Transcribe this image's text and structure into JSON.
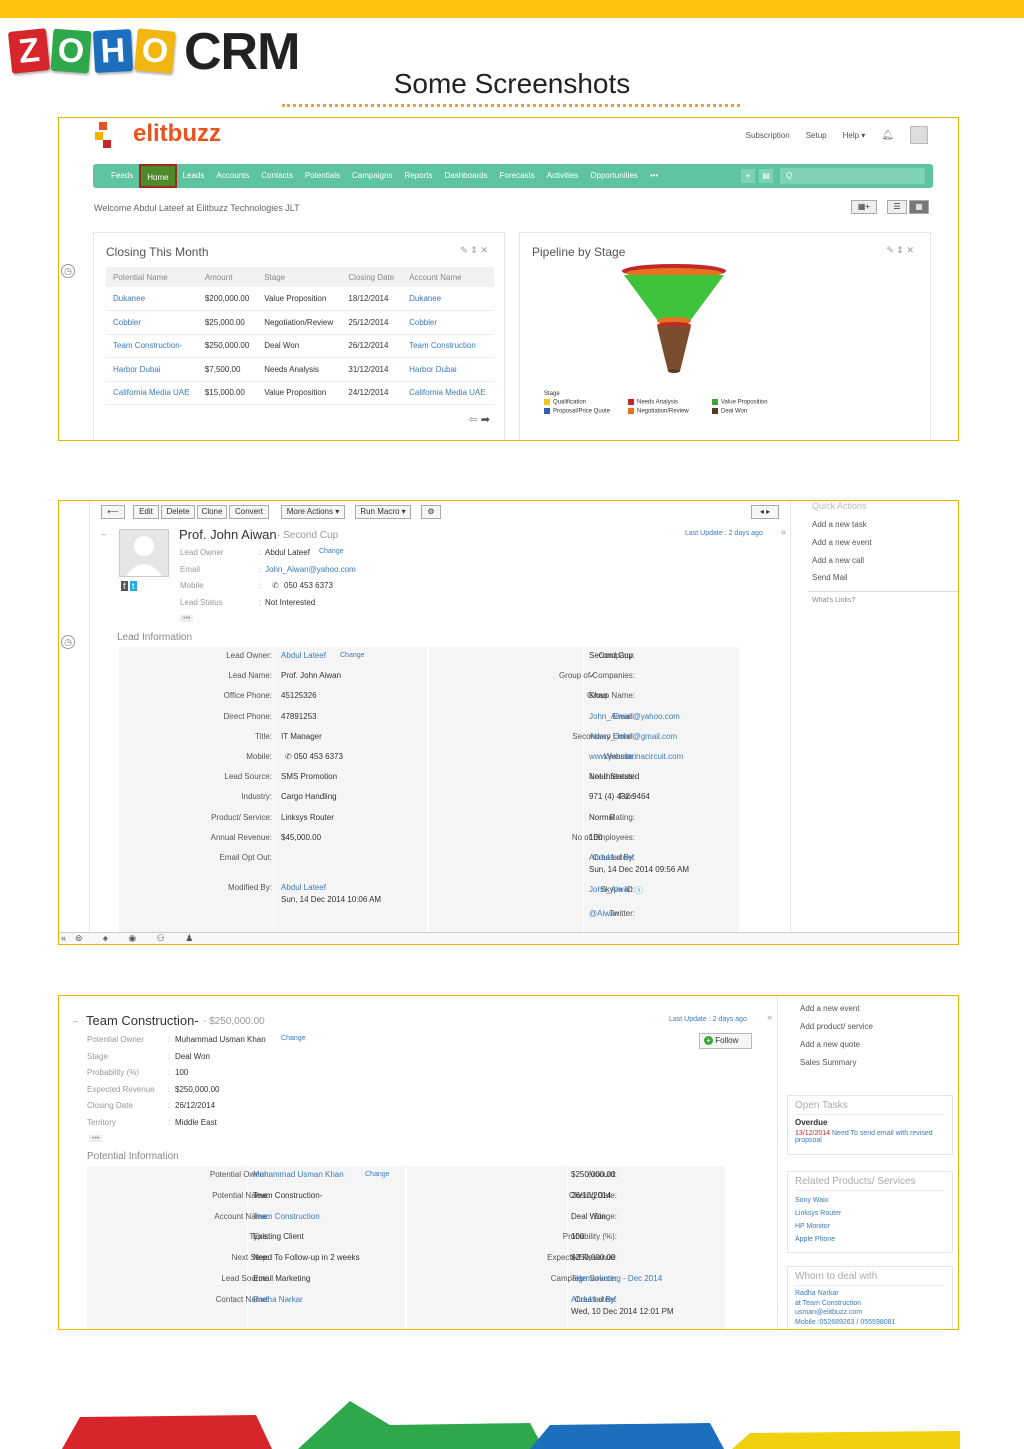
{
  "header": {
    "brand": "ZOHO",
    "product": "CRM",
    "title": "Some Screenshots"
  },
  "shot1": {
    "brand": "elitbuzz",
    "topnav": [
      "Subscription",
      "Setup",
      "Help"
    ],
    "nav": [
      "Feeds",
      "Home",
      "Leads",
      "Accounts",
      "Contacts",
      "Potentials",
      "Campaigns",
      "Reports",
      "Dashboards",
      "Forecasts",
      "Activities",
      "Opportunities",
      "•••"
    ],
    "search_placeholder": "Q",
    "welcome": "Welcome Abdul Lateef at Elitbuzz Technologies JLT",
    "closing": {
      "title": "Closing This Month",
      "columns": [
        "Potential Name",
        "Amount",
        "Stage",
        "Closing Date",
        "Account Name"
      ],
      "rows": [
        [
          "Dukanee",
          "$200,000.00",
          "Value Proposition",
          "18/12/2014",
          "Dukanee"
        ],
        [
          "Cobbler",
          "$25,000.00",
          "Negotiation/Review",
          "25/12/2014",
          "Cobbler"
        ],
        [
          "Team Construction-",
          "$250,000.00",
          "Deal Won",
          "26/12/2014",
          "Team Construction"
        ],
        [
          "Harbor Dubai",
          "$7,500.00",
          "Needs Analysis",
          "31/12/2014",
          "Harbor Dubai"
        ],
        [
          "California Media UAE",
          "$15,000.00",
          "Value Proposition",
          "24/12/2014",
          "California Media UAE"
        ]
      ]
    },
    "pipeline": {
      "title": "Pipeline by Stage",
      "legend_title": "Stage",
      "legend": [
        {
          "label": "Qualification",
          "color": "#f0c419"
        },
        {
          "label": "Needs Analysis",
          "color": "#c0282a"
        },
        {
          "label": "Value Proposition",
          "color": "#3aa635"
        },
        {
          "label": "Proposal/Price Quote",
          "color": "#2e5db3"
        },
        {
          "label": "Negotiation/Review",
          "color": "#e8731f"
        },
        {
          "label": "Deal Won",
          "color": "#5a3a22"
        }
      ]
    }
  },
  "shot2": {
    "toolbar": [
      "Edit",
      "Delete",
      "Clone",
      "Convert",
      "More Actions ▾",
      "Run Macro ▾"
    ],
    "name": "Prof. John Aiwan",
    "company_suffix": "- Second Cup",
    "last_update": "Last Update : 2 days ago",
    "summary": [
      {
        "label": "Lead Owner",
        "value": "Abdul Lateef",
        "extra": "Change"
      },
      {
        "label": "Email",
        "value": "John_Aiwan@yahoo.com"
      },
      {
        "label": "Mobile",
        "value": "050 453 6373"
      },
      {
        "label": "Lead Status",
        "value": "Not Interested"
      }
    ],
    "section": "Lead Information",
    "left": [
      [
        "Lead Owner:",
        "Abdul Lateef"
      ],
      [
        "Lead Name:",
        "Prof. John Aiwan"
      ],
      [
        "Office Phone:",
        "45125326"
      ],
      [
        "Direct Phone:",
        "47891253"
      ],
      [
        "Title:",
        "IT Manager"
      ],
      [
        "Mobile:",
        "050 453 6373"
      ],
      [
        "Lead Source:",
        "SMS Promotion"
      ],
      [
        "Industry:",
        "Cargo Handling"
      ],
      [
        "Product/ Service:",
        "Linksys Router"
      ],
      [
        "Annual Revenue:",
        "$45,000.00"
      ],
      [
        "Email Opt Out:",
        ""
      ],
      [
        "Modified By:",
        "Abdul Lateef"
      ]
    ],
    "change": "Change",
    "modified_date": "Sun, 14 Dec 2014 10:06 AM",
    "right": [
      [
        "Company:",
        "Second Cup"
      ],
      [
        "Group of Companies:",
        "✓"
      ],
      [
        "Group Name:",
        "Khan"
      ],
      [
        "Email:",
        "John_Aiwan@yahoo.com"
      ],
      [
        "Secondary Email:",
        "Aiwan_John@gmail.com"
      ],
      [
        "Website:",
        "www.yasmarinacircuit.com"
      ],
      [
        "Lead Status:",
        "Not Interested"
      ],
      [
        "Fax:",
        "971 (4) 432 9464"
      ],
      [
        "Rating:",
        "Normal"
      ],
      [
        "No of Employees:",
        "100"
      ],
      [
        "Created By:",
        "Abdul Lateef"
      ],
      [
        "Skype ID:",
        "John_Aiwan"
      ],
      [
        "Twitter:",
        "@Aiwan"
      ]
    ],
    "created_date": "Sun, 14 Dec 2014 09:56 AM",
    "quick_title": "Quick Actions",
    "quick": [
      "Add a new task",
      "Add a new event",
      "Add a new call",
      "Send Mail"
    ],
    "whats_links": "What's Links?"
  },
  "shot3": {
    "name": "Team Construction-",
    "amount": "- $250,000.00",
    "last_update": "Last Update : 2 days ago",
    "follow": "Follow",
    "summary": [
      [
        "Potential Owner",
        "Muhammad Usman Khan"
      ],
      [
        "Stage",
        "Deal Won"
      ],
      [
        "Probability (%)",
        "100"
      ],
      [
        "Expected Revenue",
        "$250,000.00"
      ],
      [
        "Closing Date",
        "26/12/2014"
      ],
      [
        "Territory",
        "Middle East"
      ]
    ],
    "change": "Change",
    "section": "Potential Information",
    "left": [
      [
        "Potential Owner:",
        "Muhammad Usman Khan"
      ],
      [
        "Potential Name:",
        "Team Construction-"
      ],
      [
        "Account Name:",
        "Team Construction"
      ],
      [
        "Type:",
        "Existing Client"
      ],
      [
        "Next Step:",
        "Need To Follow-up in 2 weeks"
      ],
      [
        "Lead Source:",
        "Email Marketing"
      ],
      [
        "Contact Name:",
        "Radha Narkar"
      ]
    ],
    "right": [
      [
        "Amount:",
        "$250,000.00"
      ],
      [
        "Closing Date:",
        "26/12/2014"
      ],
      [
        "Stage:",
        "Deal Won"
      ],
      [
        "Probability (%):",
        "100"
      ],
      [
        "Expected Revenue:",
        "$250,000.00"
      ],
      [
        "Campaign Source:",
        "Telemarketing - Dec 2014"
      ],
      [
        "Created By:",
        "Abdul Lateef"
      ]
    ],
    "created_date": "Wed, 10 Dec 2014 12:01 PM",
    "side_links": [
      "Add a new event",
      "Add product/ service",
      "Add a new quote",
      "Sales Summary"
    ],
    "open_tasks": {
      "title": "Open Tasks",
      "overdue": "Overdue",
      "date": "13/12/2014",
      "text": "Need To send email with revised propsoal"
    },
    "related": {
      "title": "Related Products/ Services",
      "items": [
        "Sony Waio",
        "Linksys Router",
        "HP Monitor",
        "Apple Phone"
      ]
    },
    "whom": {
      "title": "Whom to deal with",
      "name": "Radha Narkar",
      "company": "at Team Construction",
      "email": "usman@elitbuzz.com",
      "mobile": "Mobile :052689263 / 055598081"
    }
  },
  "colors": {
    "accent": "#ffc20e",
    "nav": "#5ec4a0",
    "link": "#3a7bbf"
  }
}
